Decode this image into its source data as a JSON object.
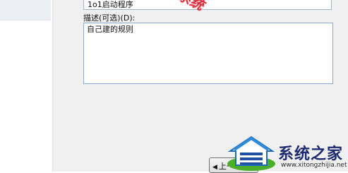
{
  "form": {
    "name_value": "1o1启动程序",
    "desc_label": "描述(可选)(D):",
    "desc_value": "自己建的规则"
  },
  "buttons": {
    "back_label": "上一"
  },
  "watermark": {
    "stamp_text": "系统",
    "logo_text": "系统之家",
    "logo_url": "www.xitongzhijia.net"
  },
  "colors": {
    "accent": "#1e2a6e",
    "stamp": "#d8182a",
    "logo_green": "#4caf2a"
  }
}
